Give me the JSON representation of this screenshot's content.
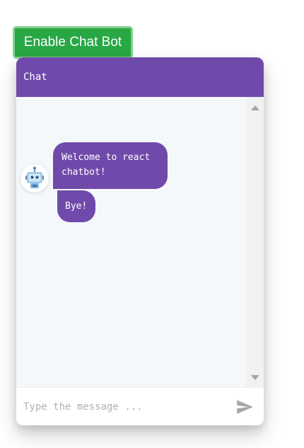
{
  "toggle": {
    "label": "Enable Chat Bot"
  },
  "chat": {
    "header_title": "Chat",
    "messages": [
      {
        "from": "bot",
        "text": "Welcome to react chatbot!"
      },
      {
        "from": "bot",
        "text": "Bye!"
      }
    ],
    "input_placeholder": "Type the message ..."
  },
  "colors": {
    "accent": "#704aaa",
    "button": "#28a745",
    "background": "#f5f8fb"
  },
  "icons": {
    "avatar": "robot-icon",
    "send": "send-icon",
    "scroll_up": "scroll-up-arrow-icon",
    "scroll_down": "scroll-down-arrow-icon"
  }
}
